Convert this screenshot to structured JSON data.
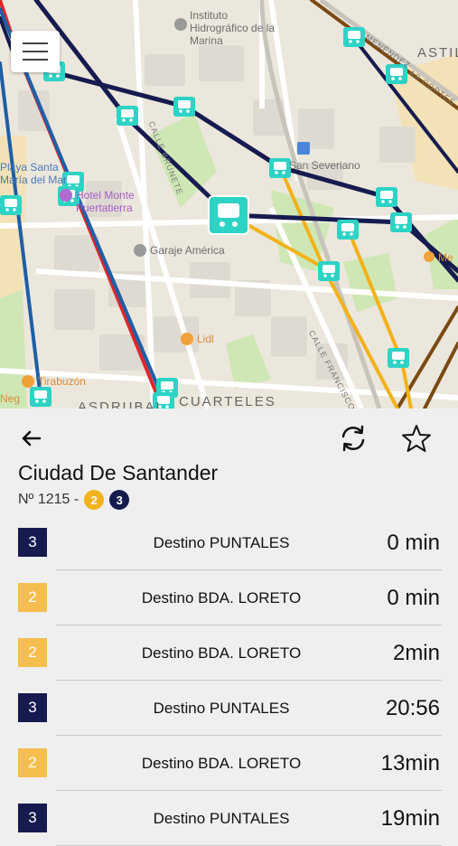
{
  "map": {
    "labels": {
      "institute": "Instituto Hidrográfico de la Marina",
      "hotel": "Hotel Monte Puertatierra",
      "playa": "Playa Santa María del Mar",
      "garaje": "Garaje América",
      "lidl": "Lidl",
      "tirabuzon": "Tirabuzón",
      "san_severiano": "San Severiano",
      "cuarteles": "CUARTELES",
      "asdrubal": "ASDRUBAL",
      "astil": "ASTIL",
      "brunete": "CALLE BRUNETE",
      "francisco": "CALLE FRANCISCO",
      "menendez": "MENÉNDEZ",
      "cortes": "AS CORTES",
      "neg": "Neg",
      "me": "Me"
    },
    "colors": {
      "navy": "#161b4f",
      "orange": "#f2b21b",
      "brown": "#7a4a12",
      "red": "#e0262a",
      "blue": "#1e5fa6",
      "stop": "#2dd3c5"
    }
  },
  "header": {
    "back_icon": "arrow-left-icon",
    "refresh_icon": "refresh-icon",
    "favorite_icon": "star-outline-icon"
  },
  "stop": {
    "name": "Ciudad De Santander",
    "number_text": "Nº 1215 -",
    "lines": [
      {
        "label": "2",
        "color": "#f2b21b",
        "text_color": "#ffffff"
      },
      {
        "label": "3",
        "color": "#161b4f",
        "text_color": "#ffffff"
      }
    ]
  },
  "arrivals": [
    {
      "line": "3",
      "color": "#161b4f",
      "destination": "Destino PUNTALES",
      "eta": "0 min"
    },
    {
      "line": "2",
      "color": "#f6bd4f",
      "destination": "Destino BDA. LORETO",
      "eta": "0 min"
    },
    {
      "line": "2",
      "color": "#f6bd4f",
      "destination": "Destino BDA. LORETO",
      "eta": "2min"
    },
    {
      "line": "3",
      "color": "#161b4f",
      "destination": "Destino PUNTALES",
      "eta": "20:56"
    },
    {
      "line": "2",
      "color": "#f6bd4f",
      "destination": "Destino BDA. LORETO",
      "eta": "13min"
    },
    {
      "line": "3",
      "color": "#161b4f",
      "destination": "Destino PUNTALES",
      "eta": "19min"
    }
  ]
}
